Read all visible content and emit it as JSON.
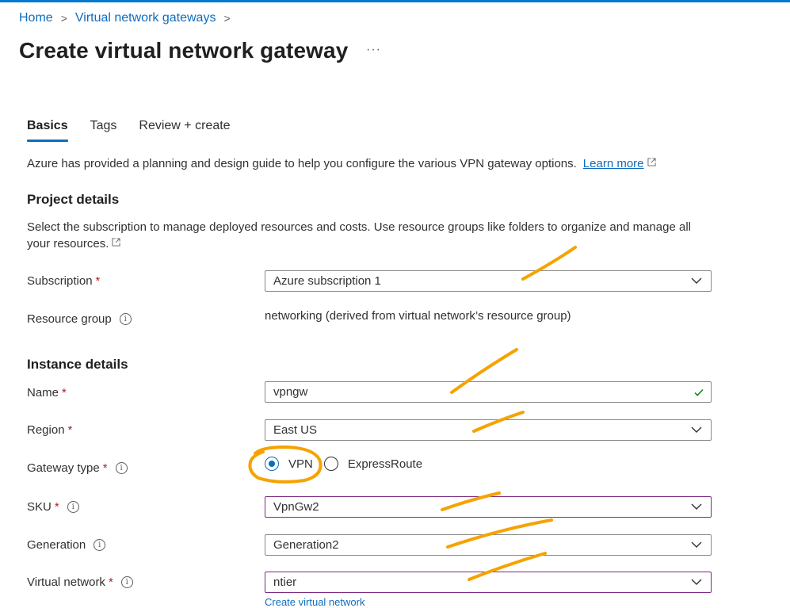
{
  "breadcrumb": {
    "home": "Home",
    "parent": "Virtual network gateways",
    "sep": ">"
  },
  "page": {
    "title": "Create virtual network gateway",
    "more": "···"
  },
  "tabs": [
    {
      "label": "Basics",
      "active": true
    },
    {
      "label": "Tags",
      "active": false
    },
    {
      "label": "Review + create",
      "active": false
    }
  ],
  "intro": {
    "text": "Azure has provided a planning and design guide to help you configure the various VPN gateway options.",
    "link": "Learn more"
  },
  "project": {
    "heading": "Project details",
    "description": "Select the subscription to manage deployed resources and costs. Use resource groups like folders to organize and manage all your resources.",
    "subscription_label": "Subscription",
    "subscription_value": "Azure subscription 1",
    "resource_group_label": "Resource group",
    "resource_group_value": "networking (derived from virtual network’s resource group)"
  },
  "instance": {
    "heading": "Instance details",
    "name_label": "Name",
    "name_value": "vpngw",
    "region_label": "Region",
    "region_value": "East US",
    "gateway_type_label": "Gateway type",
    "gateway_options": [
      "VPN",
      "ExpressRoute"
    ],
    "gateway_selected": "VPN",
    "sku_label": "SKU",
    "sku_value": "VpnGw2",
    "generation_label": "Generation",
    "generation_value": "Generation2",
    "vnet_label": "Virtual network",
    "vnet_value": "ntier",
    "create_vnet_link": "Create virtual network"
  },
  "required_marker": "*",
  "info_glyph": "i",
  "colors": {
    "accent": "#0f6cbd",
    "required": "#a4262c",
    "highlight": "#f5a300",
    "success": "#107c10",
    "field_focus": "#7a2c83"
  }
}
